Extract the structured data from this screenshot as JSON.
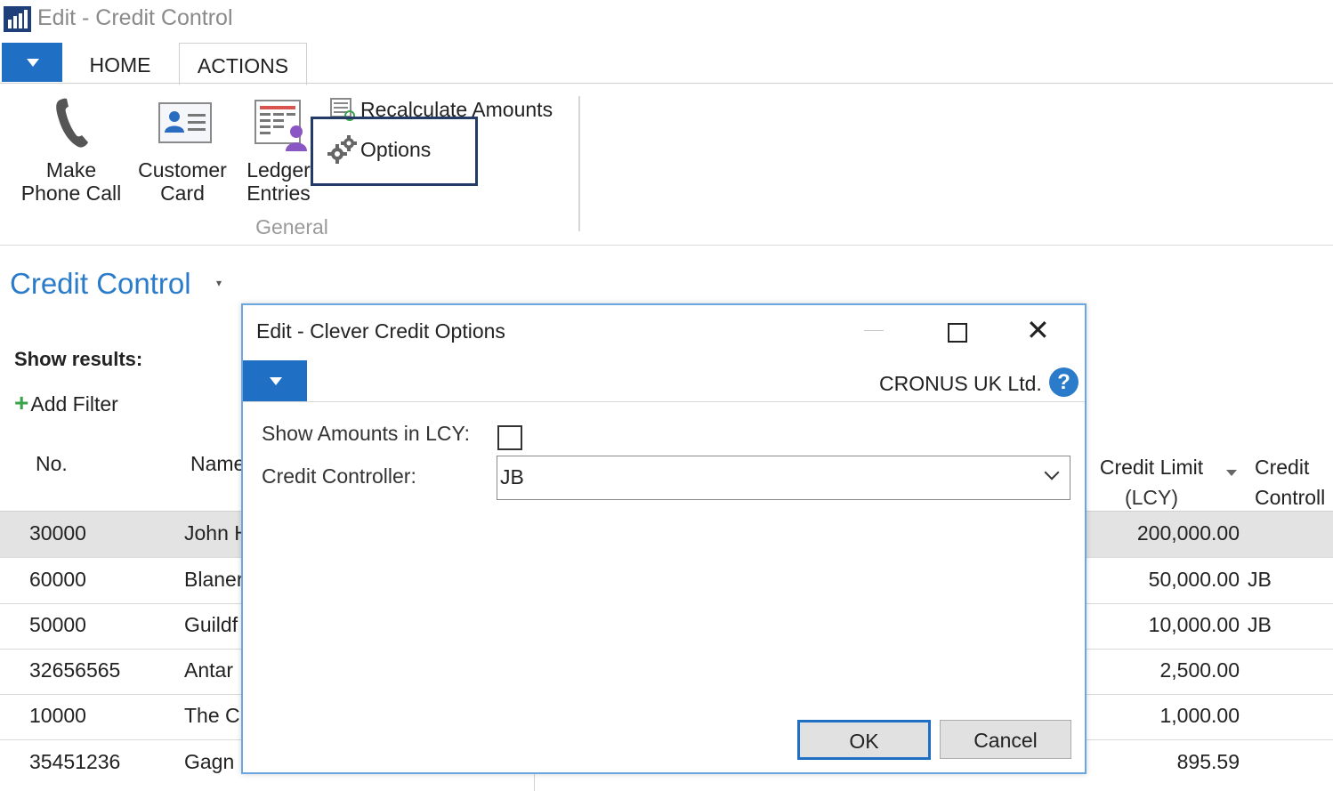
{
  "window": {
    "title": "Edit - Credit Control"
  },
  "ribbon": {
    "tabs": [
      "HOME",
      "ACTIONS"
    ],
    "active_tab": "ACTIONS",
    "buttons": {
      "make_phone_call": [
        "Make",
        "Phone Call"
      ],
      "customer_card": [
        "Customer",
        "Card"
      ],
      "ledger_entries": [
        "Ledger",
        "Entries"
      ],
      "recalculate_amounts": "Recalculate Amounts",
      "options": "Options"
    },
    "group_label": "General"
  },
  "page": {
    "title": "Credit Control",
    "show_results": "Show results:",
    "add_filter": "Add Filter"
  },
  "grid": {
    "headers": {
      "no": "No.",
      "name": "Name",
      "credit_limit": [
        "Credit Limit",
        "(LCY)"
      ],
      "credit_controller": [
        "Credit",
        "Controll"
      ]
    },
    "rows": [
      {
        "no": "30000",
        "name": "John H",
        "credit_limit": "200,000.00",
        "controller": "",
        "selected": true
      },
      {
        "no": "60000",
        "name": "Blaner",
        "credit_limit": "50,000.00",
        "controller": "JB"
      },
      {
        "no": "50000",
        "name": "Guildf",
        "credit_limit": "10,000.00",
        "controller": "JB"
      },
      {
        "no": "32656565",
        "name": "Antar",
        "credit_limit": "2,500.00",
        "controller": ""
      },
      {
        "no": "10000",
        "name": "The C",
        "credit_limit": "1,000.00",
        "controller": ""
      },
      {
        "no": "35451236",
        "name": "Gagn",
        "credit_limit": "895.59",
        "controller": ""
      }
    ]
  },
  "dialog": {
    "title": "Edit - Clever Credit Options",
    "company": "CRONUS UK Ltd.",
    "help_glyph": "?",
    "close_glyph": "✕",
    "fields": {
      "show_amounts_lcy_label": "Show Amounts in LCY:",
      "show_amounts_lcy_checked": false,
      "credit_controller_label": "Credit Controller:",
      "credit_controller_value": "JB"
    },
    "buttons": {
      "ok": "OK",
      "cancel": "Cancel"
    }
  },
  "colors": {
    "accent_blue": "#1f6fc5",
    "title_blue": "#2a7bc9",
    "options_highlight": "#233b66",
    "selected_row": "#e3e3e3"
  },
  "icons": [
    "app-logo-icon",
    "phone-icon",
    "customer-card-icon",
    "ledger-entries-icon",
    "recalculate-icon",
    "options-gears-icon",
    "add-filter-plus-icon",
    "help-icon"
  ]
}
